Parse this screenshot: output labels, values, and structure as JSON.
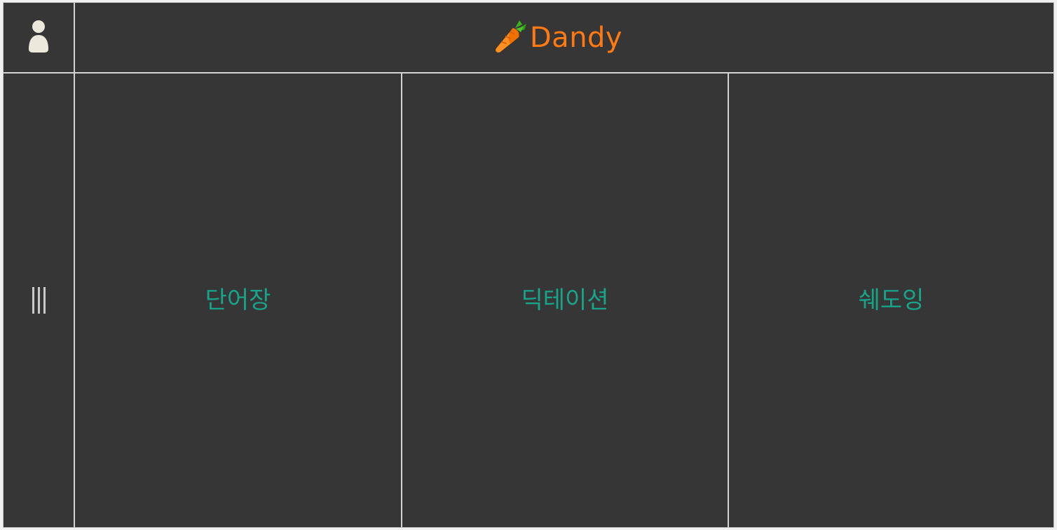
{
  "header": {
    "brand_name": "Dandy",
    "brand_icon": "carrot-icon",
    "user_icon": "user-icon",
    "colors": {
      "brand": "#ff7a12",
      "background": "#363636",
      "grid_line": "#d4d4d4",
      "user_icon": "#ece8dc"
    }
  },
  "sidebar": {
    "menu_icon": "hamburger-vertical-icon",
    "menu_color": "#c9c9c9"
  },
  "nav": {
    "label_color": "#17a589",
    "items": [
      {
        "label": "단어장"
      },
      {
        "label": "딕테이션"
      },
      {
        "label": "쉐도잉"
      }
    ]
  }
}
